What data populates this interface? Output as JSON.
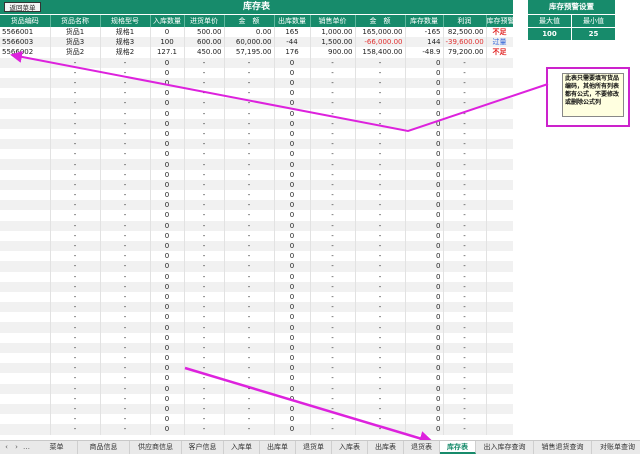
{
  "sheet": {
    "back_button": "返回菜单",
    "title": "库存表"
  },
  "table": {
    "headers": [
      "货品编码",
      "货品名称",
      "规格型号",
      "入库数量",
      "进货单价",
      "金　额",
      "出库数量",
      "销售单价",
      "金　额",
      "库存数量",
      "利润",
      "库存预警"
    ],
    "rows": [
      {
        "code": "5566001",
        "name": "货品1",
        "spec": "规格1",
        "in_qty": "0",
        "in_price": "500.00",
        "in_amount": "0.00",
        "out_qty": "165",
        "sale_price": "1,000.00",
        "out_amount": "165,000.00",
        "stock": "-165",
        "profit": "82,500.00",
        "warning": "不足",
        "warning_type": "short",
        "neg_amount": false,
        "neg_profit": false
      },
      {
        "code": "5566003",
        "name": "货品3",
        "spec": "规格3",
        "in_qty": "100",
        "in_price": "600.00",
        "in_amount": "60,000.00",
        "out_qty": "-44",
        "sale_price": "1,500.00",
        "out_amount": "-66,000.00",
        "stock": "144",
        "profit": "-39,600.00",
        "warning": "过量",
        "warning_type": "over",
        "neg_amount": true,
        "neg_profit": true
      },
      {
        "code": "5566002",
        "name": "货品2",
        "spec": "规格2",
        "in_qty": "127.1",
        "in_price": "450.00",
        "in_amount": "57,195.00",
        "out_qty": "176",
        "sale_price": "900.00",
        "out_amount": "158,400.00",
        "stock": "-48.9",
        "profit": "79,200.00",
        "warning": "不足",
        "warning_type": "short",
        "neg_amount": false,
        "neg_profit": false
      }
    ],
    "placeholder": {
      "code": "",
      "name": "-",
      "spec": "-",
      "in_qty": "0",
      "in_price": "-",
      "in_amount": "-",
      "out_qty": "0",
      "sale_price": "-",
      "out_amount": "-",
      "stock": "0",
      "profit": "-",
      "warning": ""
    }
  },
  "warning_settings": {
    "title": "库存预警设置",
    "max_label": "最大值",
    "min_label": "最小值",
    "max_value": "100",
    "min_value": "25"
  },
  "note": {
    "text": "此表只需要填写货品编码，其他所有列表都有公式，不要修改或删除公式列"
  },
  "tabs": {
    "items": [
      "菜单",
      "商品信息",
      "供应商信息",
      "客户信息",
      "入库单",
      "出库单",
      "退货单",
      "入库表",
      "出库表",
      "退货表",
      "库存表",
      "出入库存查询",
      "销售退货查询",
      "对账单查询",
      "付款登入"
    ],
    "active_index": 10
  },
  "colors": {
    "header_green": "#178b6b",
    "annotation_magenta": "#cc22cc",
    "negative_red": "#e03030",
    "over_blue": "#2b5fd8"
  }
}
